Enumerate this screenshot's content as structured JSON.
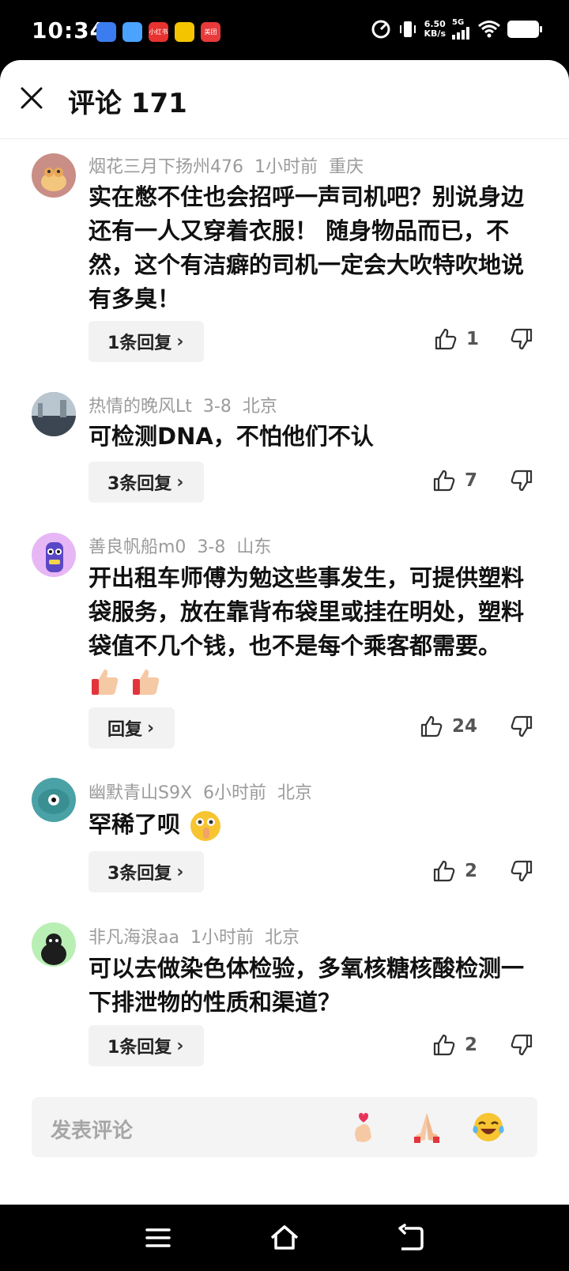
{
  "status_bar": {
    "time": "10:34",
    "apps": [
      {
        "name": "app-1",
        "color": "#3b7df0",
        "text": ""
      },
      {
        "name": "app-2",
        "color": "#4aa3ff",
        "text": ""
      },
      {
        "name": "app-3",
        "color": "#e8322f",
        "text": "小红书"
      },
      {
        "name": "app-4",
        "color": "#f5c400",
        "text": ""
      },
      {
        "name": "app-5",
        "color": "#e83a3a",
        "text": "美团"
      }
    ],
    "net_speed_value": "6.50",
    "net_speed_unit": "KB/s",
    "network": "5G"
  },
  "header": {
    "title": "评论 171"
  },
  "comments": [
    {
      "user": "烟花三月下扬州476",
      "time": "1小时前",
      "location": "重庆",
      "text": "实在憋不住也会招呼一声司机吧？别说身边还有一人又穿着衣服！ 随身物品而已，不然，这个有洁癖的司机一定会大吹特吹地说有多臭！",
      "reply_label": "1条回复",
      "likes": "1",
      "avatar_color": "#c98e86"
    },
    {
      "user": "热情的晚风Lt",
      "time": "3-8",
      "location": "北京",
      "text": "可检测DNA，不怕他们不认",
      "reply_label": "3条回复",
      "likes": "7",
      "avatar_color": "#6f7f8c"
    },
    {
      "user": "善良帆船m0",
      "time": "3-8",
      "location": "山东",
      "text": "开出租车师傅为勉这些事发生，可提供塑料袋服务，放在靠背布袋里或挂在明处，塑料袋值不几个钱，也不是每个乘客都需要。",
      "text_emojis": [
        "thumbs-up",
        "thumbs-up"
      ],
      "reply_label": "回复",
      "likes": "24",
      "avatar_color": "#e7b7f5"
    },
    {
      "user": "幽默青山S9X",
      "time": "6小时前",
      "location": "北京",
      "text": "罕稀了呗",
      "text_emojis": [
        "shushing-face"
      ],
      "reply_label": "3条回复",
      "likes": "2",
      "avatar_color": "#4aa2a6"
    },
    {
      "user": "非凡海浪aa",
      "time": "1小时前",
      "location": "北京",
      "text": "可以去做染色体检验，多氧核糖核酸检测一下排泄物的性质和渠道？",
      "reply_label": "1条回复",
      "likes": "2",
      "avatar_color": "#b9efb4"
    }
  ],
  "input": {
    "placeholder": "发表评论",
    "quick_emojis": [
      "finger-heart",
      "folded-hands",
      "laughing-crying"
    ]
  }
}
